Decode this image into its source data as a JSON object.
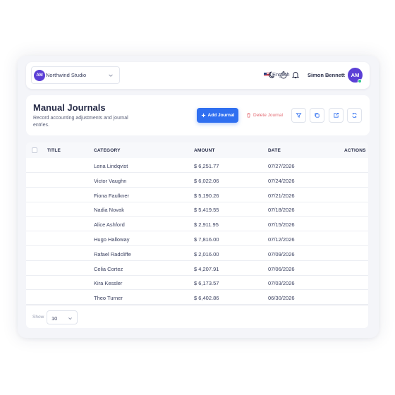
{
  "workspace": {
    "avatar": "AM",
    "name": "Northwind Studio",
    "chevron_icon": "chevron-down-icon"
  },
  "topbar": {
    "language": "English",
    "icons": [
      "flag-us-icon",
      "moon-icon",
      "stopwatch-icon",
      "bell-icon"
    ],
    "user_name": "Simon Bennett",
    "user_initials": "AM",
    "status_color": "#2fc48d"
  },
  "page": {
    "title": "Manual Journals",
    "subtitle": "Record accounting adjustments and journal entries."
  },
  "actions": {
    "add_label": "Add Journal",
    "delete_label": "Delete Journal",
    "icon_buttons": [
      "filter-icon",
      "copy-icon",
      "export-icon",
      "refresh-icon"
    ]
  },
  "table": {
    "columns": [
      "TITLE",
      "CATEGORY",
      "AMOUNT",
      "DATE",
      "ACTIONS"
    ],
    "rows": [
      {
        "category": "Lena Lindqvist",
        "amount": "$ 6,251.77",
        "date": "07/27/2026"
      },
      {
        "category": "Victor Vaughn",
        "amount": "$ 6,022.06",
        "date": "07/24/2026"
      },
      {
        "category": "Fiona Faulkner",
        "amount": "$ 5,190.26",
        "date": "07/21/2026"
      },
      {
        "category": "Nadia Novak",
        "amount": "$ 5,419.55",
        "date": "07/18/2026"
      },
      {
        "category": "Alice Ashford",
        "amount": "$ 2,911.95",
        "date": "07/15/2026"
      },
      {
        "category": "Hugo Halloway",
        "amount": "$ 7,816.00",
        "date": "07/12/2026"
      },
      {
        "category": "Rafael Radcliffe",
        "amount": "$ 2,016.00",
        "date": "07/09/2026"
      },
      {
        "category": "Celia Cortez",
        "amount": "$ 4,207.91",
        "date": "07/06/2026"
      },
      {
        "category": "Kira Kessler",
        "amount": "$ 6,173.57",
        "date": "07/03/2026"
      },
      {
        "category": "Theo Turner",
        "amount": "$ 6,402.86",
        "date": "06/30/2026"
      }
    ]
  },
  "pagination": {
    "show_label": "Show",
    "page_size": "10"
  },
  "colors": {
    "primary": "#2f6ff0",
    "avatar": "#5b3fd6",
    "danger": "#e36a72"
  }
}
